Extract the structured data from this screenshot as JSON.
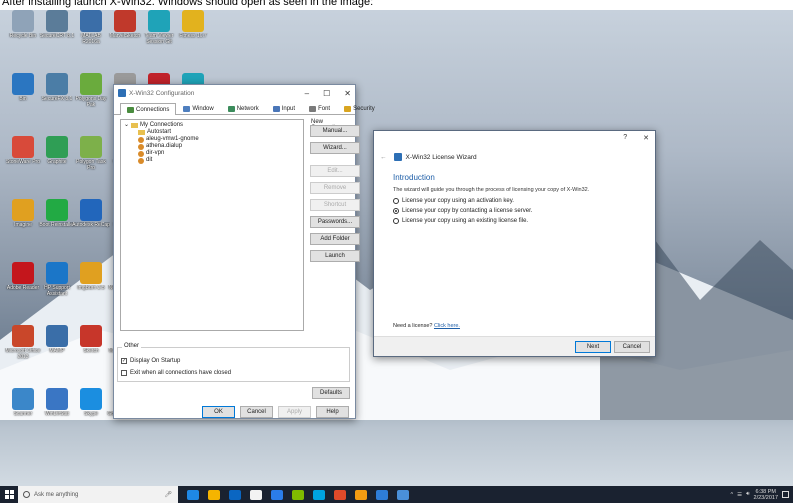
{
  "caption": "After installing launch X-Win32. Windows should open as seen in the image:",
  "desktop_icons": [
    {
      "label": "Recycle Bin",
      "color": "#8fa3b8"
    },
    {
      "label": "SecureCRT 8.1",
      "color": "#5b7c99"
    },
    {
      "label": "MATLAB R2016a",
      "color": "#3b6ea8"
    },
    {
      "label": "MarvelSketch",
      "color": "#c0392b"
    },
    {
      "label": "Team Viewer Session Git",
      "color": "#1fa3b8"
    },
    {
      "label": "Fitness 16.7",
      "color": "#e2b21e"
    },
    {
      "label": "Bin",
      "color": "#2b76c1"
    },
    {
      "label": "SecureFX 8.1",
      "color": "#4b7da6"
    },
    {
      "label": "Polygons Day Pak",
      "color": "#6aab3d"
    },
    {
      "label": "Portfolio",
      "color": "#9a9a9a"
    },
    {
      "label": "Workspace",
      "color": "#c0222a"
    },
    {
      "label": "Tray Plus",
      "color": "#1fa3b8"
    },
    {
      "label": "StoneWare Pro",
      "color": "#d84a3a"
    },
    {
      "label": "Graphite",
      "color": "#2f9e55"
    },
    {
      "label": "Polygon Task Pro",
      "color": "#7db04a"
    },
    {
      "label": "GeneBank Windows",
      "color": "#2266bb"
    },
    {
      "label": "FastStone Image Viewer",
      "color": "#e05a3a"
    },
    {
      "label": "AutoCAD 2018",
      "color": "#c21f2a"
    },
    {
      "label": "Imagine",
      "color": "#e0a020"
    },
    {
      "label": "Boot Reinstaller",
      "color": "#22aa44"
    },
    {
      "label": "Autodesk ReCap",
      "color": "#2266bb"
    },
    {
      "label": "Magic MM",
      "color": "#2a5ea8"
    },
    {
      "label": "VMware Workstation",
      "color": "#7ab33e"
    },
    {
      "label": "Autodesk Desktop",
      "color": "#1e4fa0"
    },
    {
      "label": "Adobe Reader",
      "color": "#c4161c"
    },
    {
      "label": "HP Support Assistant",
      "color": "#1b76c8"
    },
    {
      "label": "ImgBurn 2.5",
      "color": "#e0a020"
    },
    {
      "label": "Network Setup",
      "color": "#2e6fb5"
    },
    {
      "label": "ArcGIS Portal",
      "color": "#2577c4"
    },
    {
      "label": "Lenovo",
      "color": "#5588aa"
    },
    {
      "label": "Microsoft Office 2013",
      "color": "#c9472a"
    },
    {
      "label": "MAMP",
      "color": "#3a6ea8"
    },
    {
      "label": "Sketch",
      "color": "#c7362a"
    },
    {
      "label": "Mozilla Firefox",
      "color": "#e66a1f"
    },
    {
      "label": "GIS Portal Data",
      "color": "#d9a520"
    },
    {
      "label": "SOLIDWORKS 2017",
      "color": "#c41b22"
    },
    {
      "label": "Scanner",
      "color": "#3b87c9"
    },
    {
      "label": "WinDirStat",
      "color": "#3a76c4"
    },
    {
      "label": "Skype",
      "color": "#1b8ee0"
    },
    {
      "label": "Google Chrome",
      "color": "#e5b21a"
    },
    {
      "label": "GoodSync",
      "color": "#e04a36"
    },
    {
      "label": "Alarm Kit",
      "color": "#e8b91e"
    }
  ],
  "config_window": {
    "title": "X-Win32 Configuration",
    "tabs": [
      {
        "label": "Connections",
        "color": "#4a8c3f",
        "active": true
      },
      {
        "label": "Window",
        "color": "#4f7fbf",
        "active": false
      },
      {
        "label": "Network",
        "color": "#3c8c5c",
        "active": false
      },
      {
        "label": "Input",
        "color": "#4a76b8",
        "active": false
      },
      {
        "label": "Font",
        "color": "#7a7a7a",
        "active": false
      },
      {
        "label": "Security",
        "color": "#d9a520",
        "active": false
      }
    ],
    "tree_root": "My Connections",
    "tree_items": [
      "Autostart",
      "aleug-vmw1-gnome",
      "athena.dialup",
      "dir-vpn",
      "dit"
    ],
    "side_buttons_label": "New Connection",
    "side_buttons": [
      {
        "label": "Manual...",
        "disabled": false
      },
      {
        "label": "Wizard...",
        "disabled": false
      },
      {
        "label": "Edit...",
        "disabled": true
      },
      {
        "label": "Remove",
        "disabled": true
      },
      {
        "label": "Shortcut",
        "disabled": true
      },
      {
        "label": "Passwords...",
        "disabled": false
      },
      {
        "label": "Add Folder",
        "disabled": false
      },
      {
        "label": "Launch",
        "disabled": false
      }
    ],
    "other_label": "Other",
    "display_on_startup": "Display On Startup",
    "exit_when_closed": "Exit when all connections have closed",
    "defaults_button": "Defaults",
    "ok_button": "OK",
    "cancel_button": "Cancel",
    "apply_button": "Apply",
    "help_button": "Help"
  },
  "wizard_window": {
    "help": "?",
    "close": "✕",
    "title": "X-Win32 License Wizard",
    "section_title": "Introduction",
    "description": "The wizard will guide you through the process of licensing your copy of X-Win32.",
    "options": [
      {
        "label": "License your copy using an activation key.",
        "selected": false
      },
      {
        "label": "License your copy by contacting a license server.",
        "selected": true
      },
      {
        "label": "License your copy using an existing license file.",
        "selected": false
      }
    ],
    "need_license": "Need a license?",
    "click_here": "Click here.",
    "next_button": "Next",
    "cancel_button": "Cancel"
  },
  "taskbar": {
    "search_placeholder": "Ask me anything",
    "time": "6:38 PM",
    "date": "2/23/2017",
    "app_colors": [
      "#1e88e5",
      "#f5b400",
      "#0a66c2",
      "#f3f3f3",
      "#2b7de9",
      "#7fba00",
      "#00a3e0",
      "#e04a2a",
      "#f39c12",
      "#2e7dd7",
      "#4a90d9"
    ]
  }
}
